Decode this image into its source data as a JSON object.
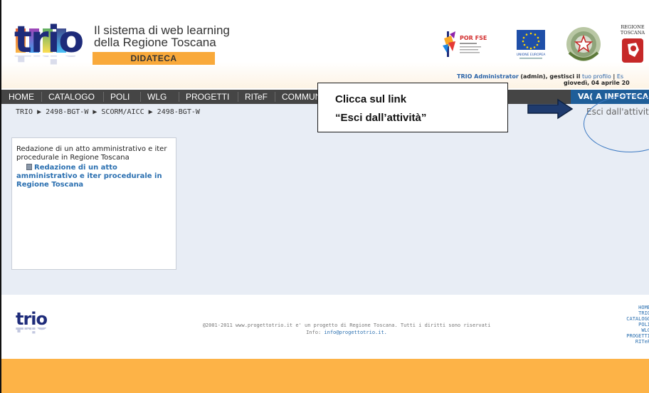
{
  "header": {
    "logo_text": "trio",
    "tagline_line1": "Il sistema di web learning",
    "tagline_line2": "della Regione Toscana",
    "section": "DIDATECA",
    "por_logo_text": "POR FSE",
    "eu_logo_text": "UNIONE EUROPEA",
    "regione_logo_text_1": "REGIONE",
    "regione_logo_text_2": "TOSCANA",
    "user_name": "TRIO Administrator",
    "user_role": "(admin), gestisci il",
    "profile_link": "tuo profilo",
    "separator": "|",
    "exit_short": "Es",
    "date": "giovedì, 04 aprile 20"
  },
  "nav": {
    "items": [
      "HOME",
      "CATALOGO",
      "POLI",
      "WLG",
      "PROGETTI",
      "RITeF",
      "COMMUN"
    ],
    "infoteca": "VA( A INFOTECA"
  },
  "breadcrumb": "TRIO ▶ 2498-BGT-W ▶ SCORM/AICC ▶ 2498-BGT-W",
  "exit_activity": "Esci dall'attività",
  "panel": {
    "title": "Redazione di un atto amministrativo e iter procedurale in Regione Toscana",
    "link": "Redazione di un atto amministrativo e iter procedurale in Regione Toscana"
  },
  "callout": {
    "line1": "Clicca sul link",
    "line2": "“Esci dall’attività”"
  },
  "footer": {
    "logo_text": "trio",
    "copyright": "@2001-2011 www.progettotrio.it e' un progetto di Regione Toscana. Tutti i diritti sono riservati",
    "info_label": "Info:",
    "info_email": "info@progettotrio.it.",
    "links": [
      "HOME",
      "TRIO",
      "CATALOGO",
      "POLI",
      "WLG",
      "PROGETTI",
      "RITeF"
    ]
  },
  "colors": {
    "nav_bg": "#454545",
    "infoteca_bg": "#1f5e99",
    "accent_orange": "#fdb347",
    "main_bg": "#e8edf5",
    "link_blue": "#2a6fb0"
  }
}
